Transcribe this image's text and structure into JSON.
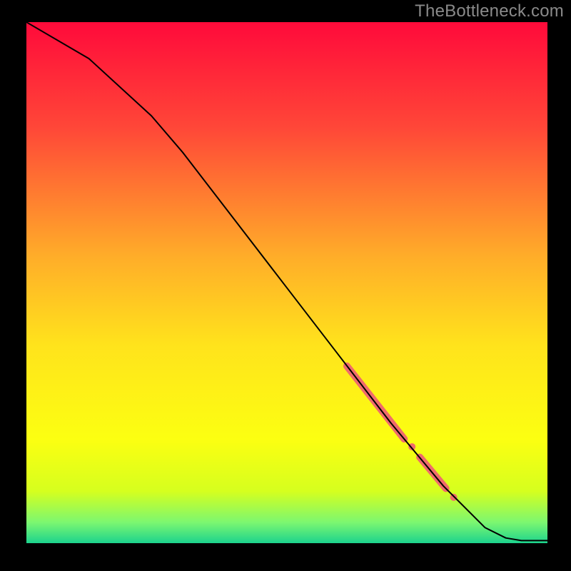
{
  "watermark": "TheBottleneck.com",
  "chart_data": {
    "type": "line",
    "title": "",
    "xlabel": "",
    "ylabel": "",
    "xlim": [
      0,
      100
    ],
    "ylim": [
      0,
      100
    ],
    "grid": false,
    "legend": null,
    "background_gradient": {
      "orientation": "vertical",
      "stops": [
        {
          "pos": 0.0,
          "color": "#ff0a3a"
        },
        {
          "pos": 0.2,
          "color": "#ff4638"
        },
        {
          "pos": 0.45,
          "color": "#ffad29"
        },
        {
          "pos": 0.62,
          "color": "#ffe31c"
        },
        {
          "pos": 0.8,
          "color": "#fcff11"
        },
        {
          "pos": 0.9,
          "color": "#d6ff1e"
        },
        {
          "pos": 0.96,
          "color": "#7cf770"
        },
        {
          "pos": 1.0,
          "color": "#1cd38d"
        }
      ]
    },
    "series": [
      {
        "name": "main-curve",
        "color": "#000000",
        "stroke_width": 2,
        "x": [
          0,
          12,
          24,
          30,
          40,
          50,
          60,
          70,
          80,
          88,
          92,
          95,
          100
        ],
        "y": [
          100,
          93,
          82,
          75,
          62,
          49,
          36,
          23,
          11,
          3,
          1,
          0.5,
          0.5
        ]
      }
    ],
    "highlight": {
      "color": "#ef6b6b",
      "segments": [
        {
          "x0": 61.5,
          "y0": 34.0,
          "x1": 72.5,
          "y1": 20.0,
          "width": 10
        },
        {
          "x0": 75.5,
          "y0": 16.5,
          "x1": 80.5,
          "y1": 10.5,
          "width": 10
        }
      ],
      "dots": [
        {
          "x": 74.0,
          "y": 18.5,
          "r": 5
        },
        {
          "x": 82.0,
          "y": 8.8,
          "r": 5
        }
      ]
    }
  }
}
